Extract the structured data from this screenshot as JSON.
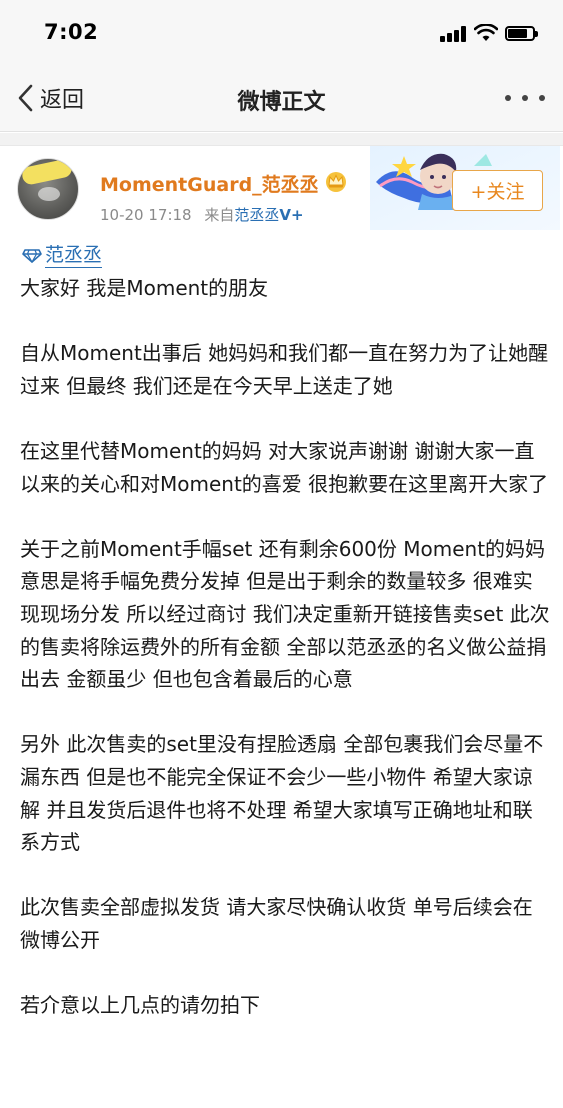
{
  "status_bar": {
    "time": "7:02"
  },
  "nav": {
    "back_label": "返回",
    "title": "微博正文"
  },
  "post": {
    "author": {
      "name": "MomentGuard_范丞丞"
    },
    "timestamp": "10-20 17:18",
    "source_prefix": "来自",
    "source_name": "范丞丞",
    "source_badge": "V+",
    "follow_label": "+关注",
    "mention": "范丞丞",
    "paragraphs": [
      "大家好 我是Moment的朋友",
      "自从Moment出事后 她妈妈和我们都一直在努力为了让她醒过来 但最终 我们还是在今天早上送走了她",
      "在这里代替Moment的妈妈 对大家说声谢谢 谢谢大家一直以来的关心和对Moment的喜爱 很抱歉要在这里离开大家了",
      "关于之前Moment手幅set 还有剩余600份 Moment的妈妈意思是将手幅免费分发掉 但是出于剩余的数量较多 很难实现现场分发 所以经过商讨 我们决定重新开链接售卖set 此次的售卖将除运费外的所有金额 全部以范丞丞的名义做公益捐出去 金额虽少 但也包含着最后的心意",
      "另外 此次售卖的set里没有捏脸透扇 全部包裹我们会尽量不漏东西 但是也不能完全保证不会少一些小物件 希望大家谅解 并且发货后退件也将不处理 希望大家填写正确地址和联系方式",
      "此次售卖全部虚拟发货 请大家尽快确认收货 单号后续会在微博公开",
      "若介意以上几点的请勿拍下"
    ]
  },
  "colors": {
    "username": "#e07a1e",
    "link": "#2a6fb3",
    "follow_border": "#e8a64a",
    "follow_text": "#e8871e"
  },
  "icons": [
    "back-chevron-icon",
    "more-dots-icon",
    "vip-crown-icon",
    "diamond-icon"
  ]
}
